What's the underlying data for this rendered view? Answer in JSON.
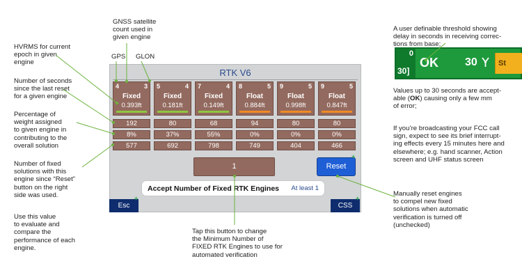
{
  "screen": {
    "title": "RTK V6",
    "engines": [
      {
        "gps": "4",
        "glon": "3",
        "status": "Fixed",
        "hvrms": "0.393ft",
        "weight": "192",
        "percent": "8%",
        "fixed_count": "577",
        "bar_color": "#8ec63f"
      },
      {
        "gps": "5",
        "glon": "4",
        "status": "Fixed",
        "hvrms": "0.181ft",
        "weight": "80",
        "percent": "37%",
        "fixed_count": "692",
        "bar_color": "#8ec63f"
      },
      {
        "gps": "7",
        "glon": "4",
        "status": "Fixed",
        "hvrms": "0.149ft",
        "weight": "68",
        "percent": "55%",
        "fixed_count": "798",
        "bar_color": "#8ec63f"
      },
      {
        "gps": "8",
        "glon": "5",
        "status": "Float",
        "hvrms": "0.884ft",
        "weight": "94",
        "percent": "0%",
        "fixed_count": "749",
        "bar_color": "#f08a24"
      },
      {
        "gps": "9",
        "glon": "5",
        "status": "Float",
        "hvrms": "0.998ft",
        "weight": "80",
        "percent": "0%",
        "fixed_count": "404",
        "bar_color": "#f08a24"
      },
      {
        "gps": "9",
        "glon": "5",
        "status": "Float",
        "hvrms": "0.847ft",
        "weight": "80",
        "percent": "0%",
        "fixed_count": "466",
        "bar_color": "#f08a24"
      }
    ],
    "min_fixed_value": "1",
    "reset_label": "Reset",
    "accept_label": "Accept Number of Fixed RTK Engines",
    "accept_value": "At least 1",
    "esc_label": "Esc",
    "css_label": "CSS"
  },
  "status_strip": {
    "top_number": "0",
    "bottom_number": "30]",
    "ok_label": "OK",
    "delay_value": "30",
    "next_label": "St",
    "antenna_icon": "antenna-icon"
  },
  "annotations": {
    "gnss": "GNSS satellite\ncount used in\ngiven engine",
    "gps": "GPS",
    "glon": "GLON",
    "hvrms": "HVRMS for current\nepoch in given\nengine",
    "seconds": "Number of seconds\nsince the last reset\nfor a given engine",
    "percentage": "Percentage of\nweight assigned\nto given engine in\ncontributing to the\noverall solution",
    "fixed": "Number of fixed\nsolutions with this\nengine since “Reset”\nbutton on the right\nside was used.",
    "use": "Use this value\nto evaluate and\ncompare the\nperformance of each\nengine.",
    "tap": "Tap this button to change\nthe Minimum Number of\nFIXED RTK Engines to use for\nautomated verification",
    "threshold": "A user definable threshold showing\ndelay in seconds in receiving correc-\ntions from base;",
    "values_pre": "Values up to 30 seconds are accept-\nable (",
    "values_ok": "OK",
    "values_post": ") causing only a few mm\nof error;",
    "broadcast": "If you’re broadcasting your FCC call\nsign, expect to see its brief interrupt-\ning effects every 15 minutes here and\nelsewhere; e.g. hand scanner, Action\nscreen and UHF status screen",
    "manual": "Manually reset engines\nto compel new fixed\nsolutions when automatic\nverification is turned off\n(unchecked)"
  }
}
